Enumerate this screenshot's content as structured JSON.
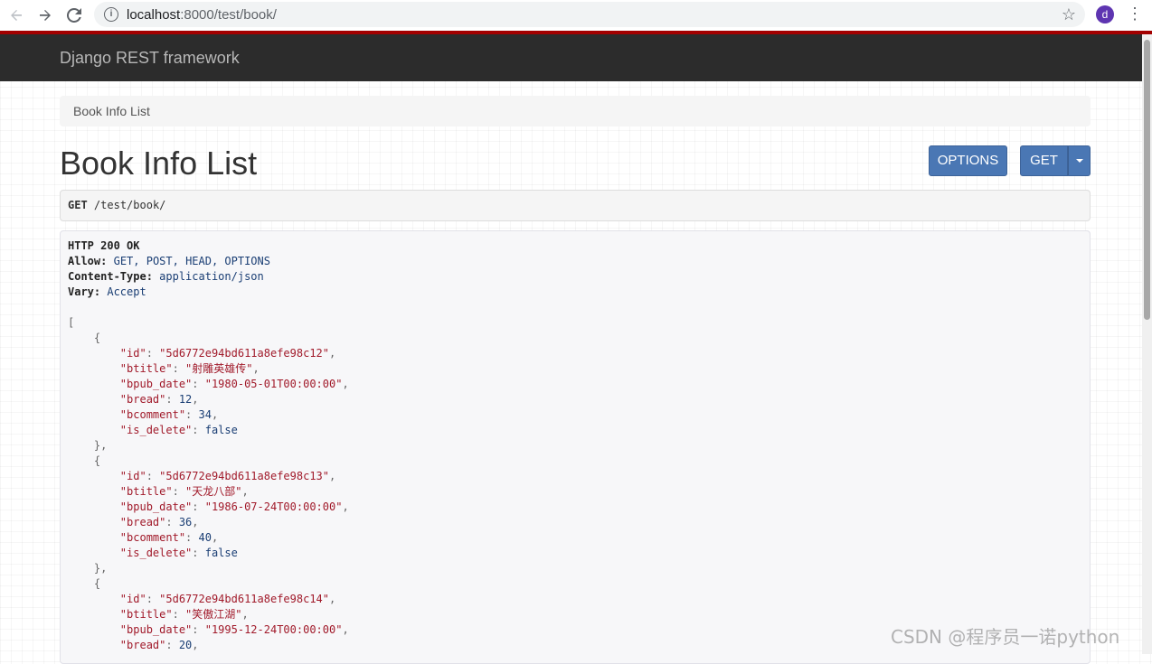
{
  "browser": {
    "url_host": "localhost",
    "url_rest": ":8000/test/book/",
    "profile_initial": "d"
  },
  "navbar": {
    "brand": "Django REST framework"
  },
  "breadcrumb": {
    "item": "Book Info List"
  },
  "page": {
    "title": "Book Info List"
  },
  "buttons": {
    "options": "OPTIONS",
    "get": "GET"
  },
  "request": {
    "method": "GET",
    "path": "/test/book/"
  },
  "response": {
    "status": "HTTP 200 OK",
    "headers": [
      {
        "name": "Allow:",
        "value": "GET, POST, HEAD, OPTIONS"
      },
      {
        "name": "Content-Type:",
        "value": "application/json"
      },
      {
        "name": "Vary:",
        "value": "Accept"
      }
    ],
    "records": [
      {
        "id": "\"5d6772e94bd611a8efe98c12\"",
        "btitle": "\"射雕英雄传\"",
        "bpub_date": "\"1980-05-01T00:00:00\"",
        "bread": "12",
        "bcomment": "34",
        "is_delete": "false"
      },
      {
        "id": "\"5d6772e94bd611a8efe98c13\"",
        "btitle": "\"天龙八部\"",
        "bpub_date": "\"1986-07-24T00:00:00\"",
        "bread": "36",
        "bcomment": "40",
        "is_delete": "false"
      },
      {
        "id": "\"5d6772e94bd611a8efe98c14\"",
        "btitle": "\"笑傲江湖\"",
        "bpub_date": "\"1995-12-24T00:00:00\"",
        "bread": "20"
      }
    ]
  },
  "watermark": "CSDN @程序员一诺python",
  "icons": {
    "back": "arrow-left-icon",
    "forward": "arrow-right-icon",
    "reload": "reload-icon",
    "info": "info-icon",
    "star": "star-icon",
    "menu": "kebab-menu-icon",
    "caret": "caret-down-icon"
  }
}
